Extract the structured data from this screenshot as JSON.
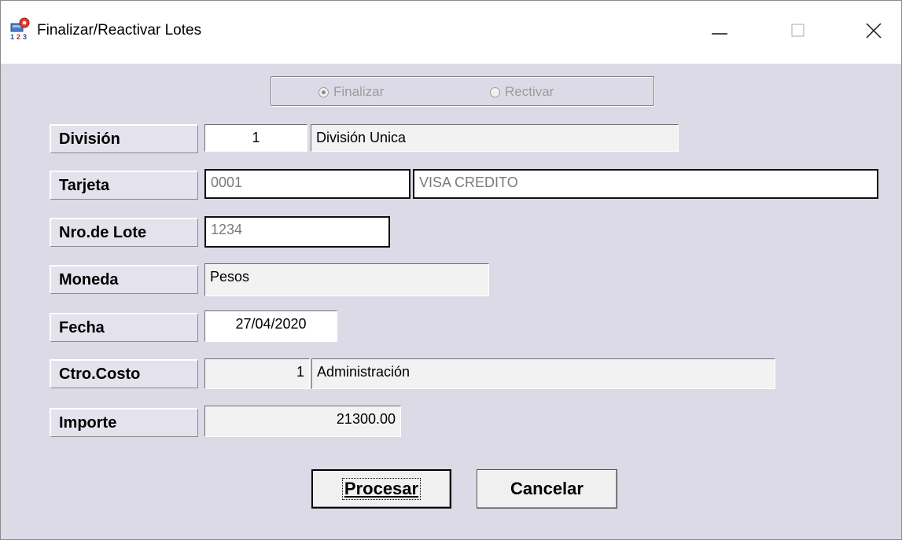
{
  "window": {
    "title": "Finalizar/Reactivar Lotes",
    "icon": "app-lotes-icon",
    "controls": {
      "minimize": "minimize-icon",
      "maximize": "maximize-icon",
      "close": "close-icon"
    }
  },
  "mode": {
    "options": [
      "Finalizar",
      "Rectivar"
    ],
    "selected": "Finalizar",
    "enabled": false
  },
  "form": {
    "division": {
      "label": "División",
      "code": "1",
      "name": "División Unica"
    },
    "tarjeta": {
      "label": "Tarjeta",
      "code": "0001",
      "name": "VISA CREDITO"
    },
    "lote": {
      "label": "Nro.de Lote",
      "value": "1234"
    },
    "moneda": {
      "label": "Moneda",
      "value": "Pesos"
    },
    "fecha": {
      "label": "Fecha",
      "value": "27/04/2020"
    },
    "ctro_costo": {
      "label": "Ctro.Costo",
      "code": "1",
      "name": "Administración"
    },
    "importe": {
      "label": "Importe",
      "value": "21300.00"
    }
  },
  "buttons": {
    "procesar": "Procesar",
    "cancelar": "Cancelar"
  },
  "colors": {
    "window_bg": "#dcdae6",
    "titlebar_bg": "#ffffff",
    "disabled_text": "#9d9d9d"
  }
}
